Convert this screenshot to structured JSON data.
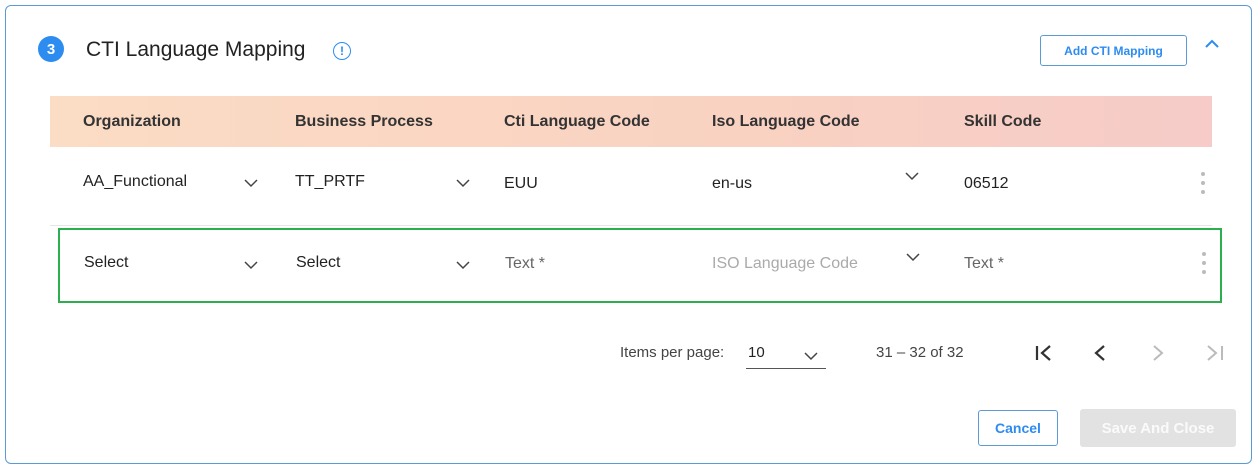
{
  "section": {
    "step": "3",
    "title": "CTI Language Mapping",
    "info_icon": "info-icon",
    "add_button": "Add CTI Mapping",
    "collapse_icon": "chevron-up-icon"
  },
  "table": {
    "headers": [
      "Organization",
      "Business Process",
      "Cti Language Code",
      "Iso Language Code",
      "Skill Code"
    ],
    "rows": [
      {
        "organization": "AA_Functional",
        "business_process": "TT_PRTF",
        "cti_language_code": "EUU",
        "iso_language_code": "en-us",
        "skill_code": "06512"
      },
      {
        "organization": "Select",
        "business_process": "Select",
        "cti_language_code": "Text *",
        "iso_language_code": "ISO Language Code",
        "skill_code": "Text *"
      }
    ]
  },
  "pagination": {
    "items_per_page_label": "Items per page:",
    "items_per_page_value": "10",
    "range_label": "31 – 32 of 32"
  },
  "footer": {
    "cancel": "Cancel",
    "save": "Save And Close"
  },
  "colors": {
    "accent": "#2d8cf0",
    "highlight_border": "#2fae4f",
    "header_gradient_start": "#fbdcc4",
    "header_gradient_end": "#f6cbc8"
  }
}
